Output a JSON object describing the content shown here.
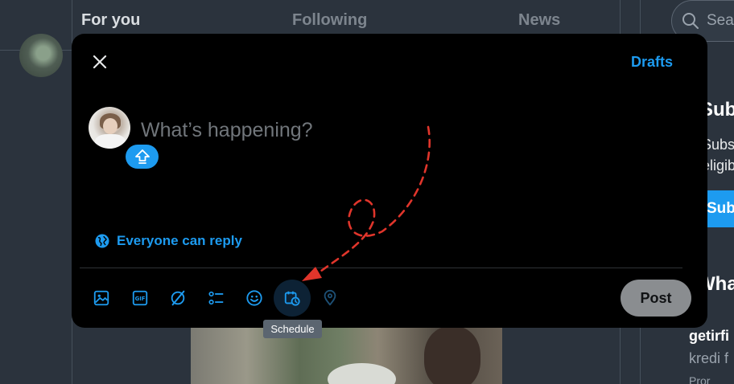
{
  "background": {
    "tabs": [
      {
        "label": "For you",
        "active": true
      },
      {
        "label": "Following",
        "active": false
      },
      {
        "label": "News",
        "active": false
      }
    ],
    "search": {
      "placeholder": "Sea",
      "icon": "search-icon"
    },
    "sidebar": {
      "title": "Subs",
      "line1": "Subsc",
      "line2": "eligibl",
      "button_label": "Sub",
      "title2": "Wha",
      "account_name": "getirfi",
      "account_sub": "kredi f",
      "promo": "Pror"
    }
  },
  "compose": {
    "drafts_label": "Drafts",
    "placeholder": "What’s happening?",
    "reply_setting": "Everyone can reply",
    "post_label": "Post",
    "toolbar": [
      {
        "name": "media-icon"
      },
      {
        "name": "gif-icon"
      },
      {
        "name": "grok-icon"
      },
      {
        "name": "poll-icon"
      },
      {
        "name": "emoji-icon"
      },
      {
        "name": "schedule-icon",
        "highlighted": true
      },
      {
        "name": "location-icon"
      }
    ],
    "tooltip": "Schedule"
  },
  "colors": {
    "accent": "#1d9bf0",
    "modal_bg": "#000000",
    "annotation": "#e0352b"
  }
}
